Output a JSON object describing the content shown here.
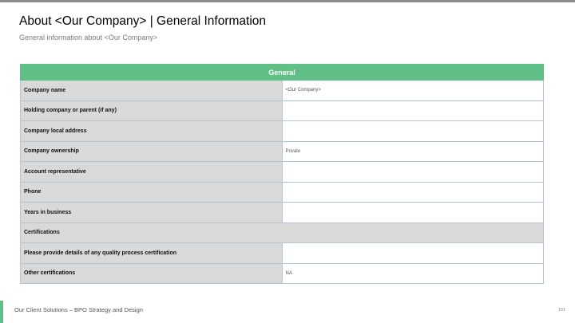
{
  "title": "About <Our Company> | General Information",
  "subtitle": "General information about <Our Company>",
  "table": {
    "header": "General",
    "rows": [
      {
        "label": "Company name",
        "value": "<Our Company>"
      },
      {
        "label": "Holding company or parent (if any)",
        "value": ""
      },
      {
        "label": "Company local address",
        "value": ""
      },
      {
        "label": "Company ownership",
        "value": "Private"
      },
      {
        "label": "Account representative",
        "value": ""
      },
      {
        "label": "Phone",
        "value": ""
      },
      {
        "label": "Years in business",
        "value": ""
      },
      {
        "label": "Certifications",
        "section": true
      },
      {
        "label": "Please provide details of any quality process certification",
        "value": ""
      },
      {
        "label": "Other certifications",
        "value": "NA"
      }
    ]
  },
  "footer": {
    "text": "Our Client Solutions – BPO Strategy and Design",
    "page_number": "101"
  },
  "colors": {
    "accent_green": "#60bf86",
    "label_gray": "#d9d9d9",
    "border_blue": "#b4c3d6"
  }
}
